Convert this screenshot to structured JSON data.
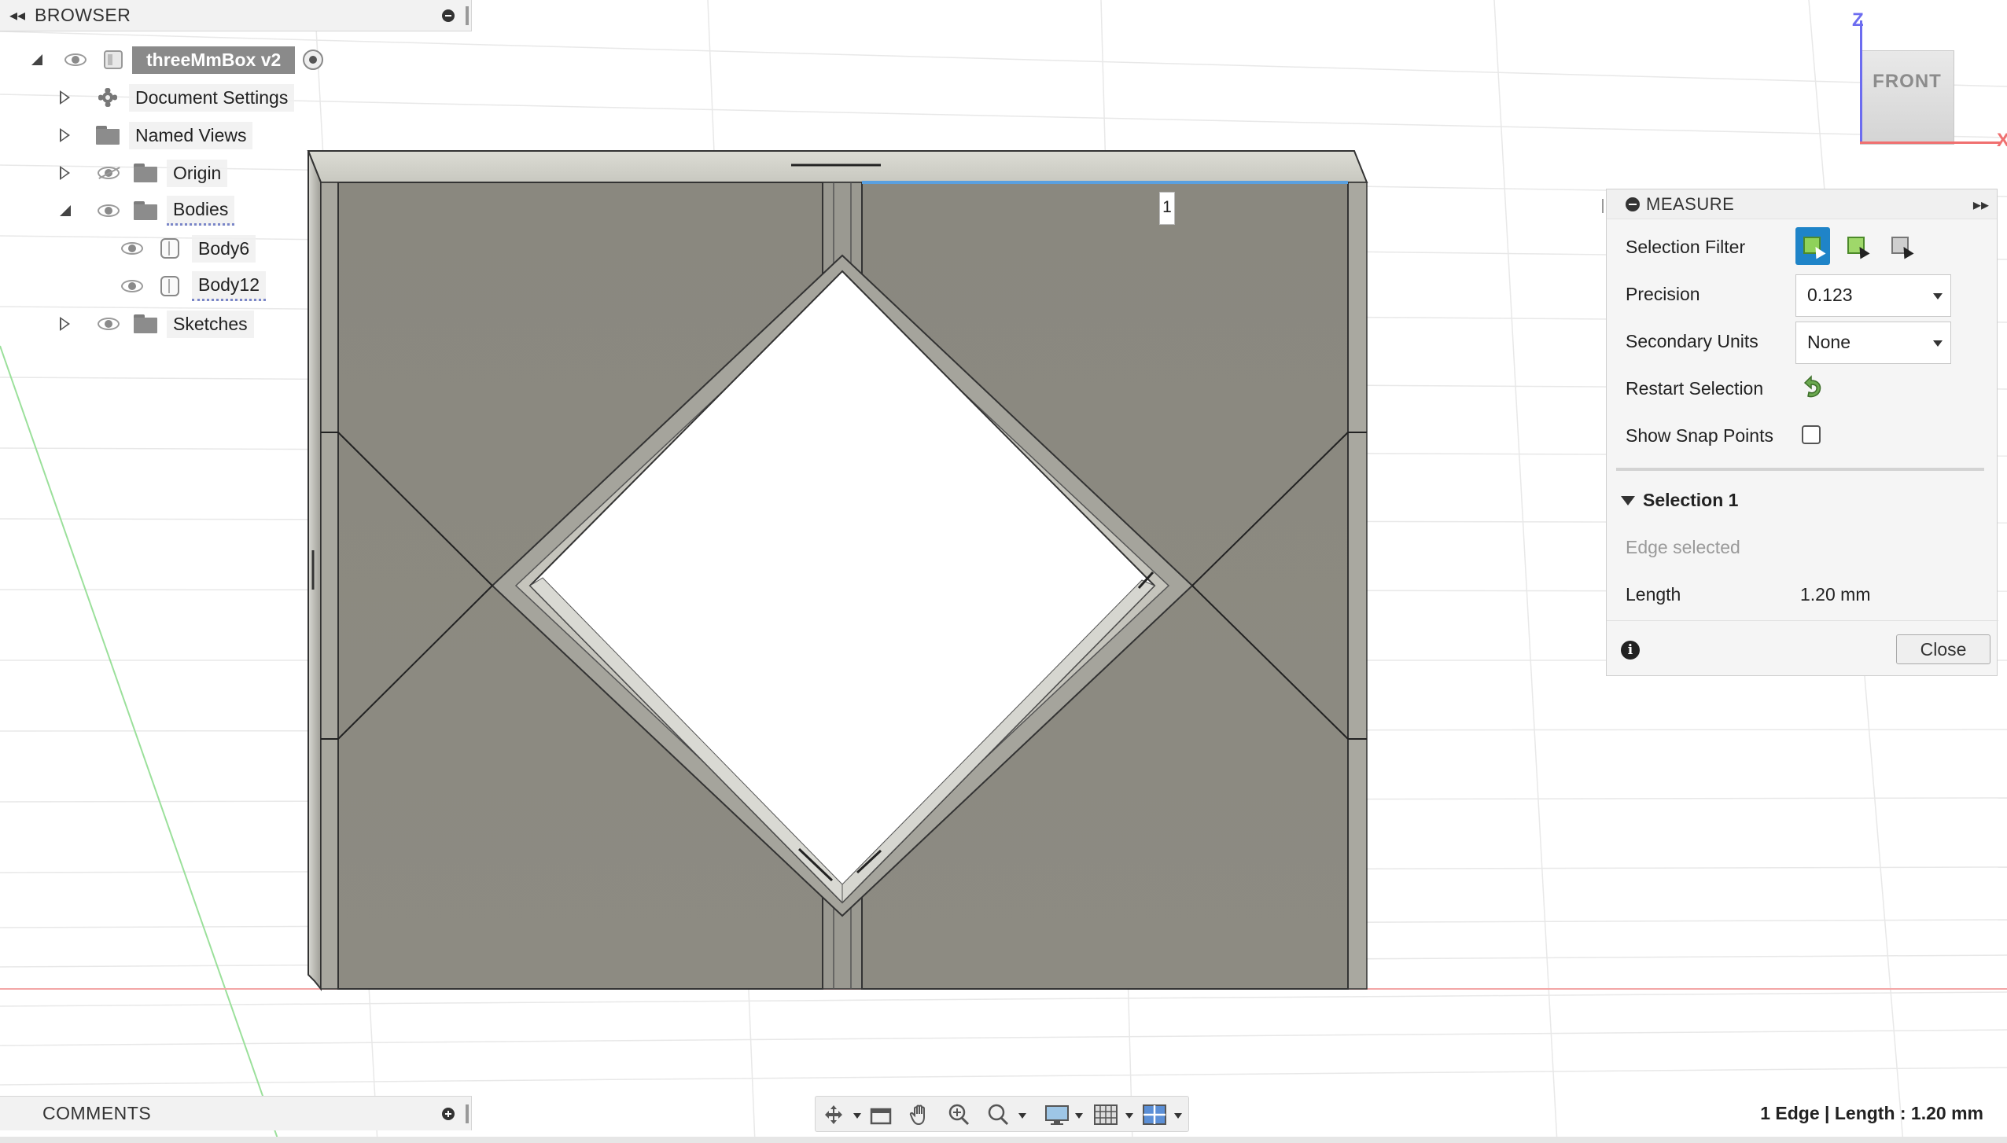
{
  "browser": {
    "title": "BROWSER",
    "root": "threeMmBox v2",
    "items": [
      {
        "label": "Document Settings"
      },
      {
        "label": "Named Views"
      },
      {
        "label": "Origin"
      },
      {
        "label": "Bodies"
      },
      {
        "label": "Body6"
      },
      {
        "label": "Body12"
      },
      {
        "label": "Sketches"
      }
    ]
  },
  "viewcube": {
    "face": "FRONT",
    "axis_z": "Z",
    "axis_x": "X"
  },
  "marker": {
    "label": "1"
  },
  "measure": {
    "title": "MEASURE",
    "selection_filter_label": "Selection Filter",
    "precision_label": "Precision",
    "precision_value": "0.123",
    "secondary_units_label": "Secondary Units",
    "secondary_units_value": "None",
    "restart_selection_label": "Restart Selection",
    "show_snap_points_label": "Show Snap Points",
    "selection_header": "Selection 1",
    "edge_selected": "Edge selected",
    "length_label": "Length",
    "length_value": "1.20 mm",
    "close_label": "Close",
    "info": "i"
  },
  "comments": {
    "title": "COMMENTS"
  },
  "status_bar": {
    "text": "1 Edge | Length : 1.20 mm"
  },
  "colors": {
    "selection_accent": "#1f84c8",
    "model_face": "#8b8a80",
    "axis_z": "#6c6cf0",
    "axis_x": "#f07070"
  }
}
